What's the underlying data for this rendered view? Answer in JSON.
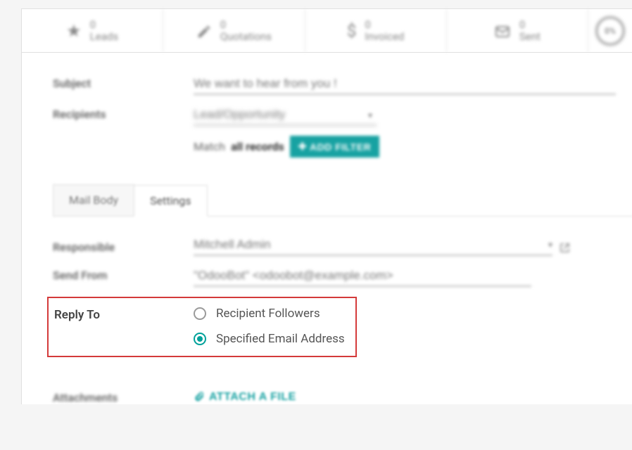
{
  "stats": {
    "leads": {
      "count": "0",
      "label": "Leads"
    },
    "quotations": {
      "count": "0",
      "label": "Quotations"
    },
    "invoiced": {
      "count": "0",
      "label": "Invoiced"
    },
    "sent": {
      "count": "0",
      "label": "Sent"
    },
    "gauge": "0%"
  },
  "form": {
    "subject_label": "Subject",
    "subject_value": "We want to hear from you !",
    "recipients_label": "Recipients",
    "recipients_value": "Lead/Opportunity",
    "match_text_1": "Match",
    "match_text_2": "all records",
    "add_filter_label": "ADD FILTER"
  },
  "tabs": {
    "mail_body": "Mail Body",
    "settings": "Settings"
  },
  "settings": {
    "responsible_label": "Responsible",
    "responsible_value": "Mitchell Admin",
    "send_from_label": "Send From",
    "send_from_value": "\"OdooBot\" <odoobot@example.com>",
    "reply_to_label": "Reply To",
    "reply_options": {
      "followers": "Recipient Followers",
      "specified": "Specified Email Address"
    },
    "reply_selected": "specified",
    "attachments_label": "Attachments",
    "attach_button": "ATTACH A FILE"
  }
}
